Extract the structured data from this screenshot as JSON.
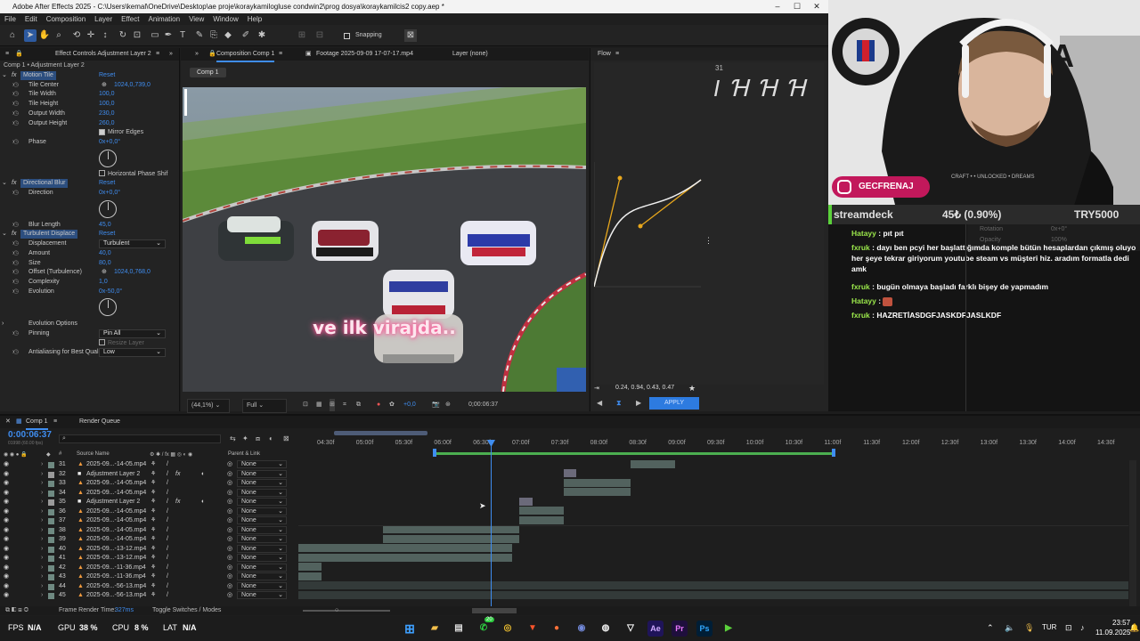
{
  "window": {
    "title": "Adobe After Effects 2025 - C:\\Users\\kemal\\OneDrive\\Desktop\\ae proje\\koraykamilogluse condwin2\\prog dosya\\koraykamilcis2 copy.aep *"
  },
  "menu": [
    "File",
    "Edit",
    "Composition",
    "Layer",
    "Effect",
    "Animation",
    "View",
    "Window",
    "Help"
  ],
  "toolbar": {
    "snapping": "Snapping"
  },
  "effects_panel": {
    "tab": "Effect Controls Adjustment Layer 2",
    "subtitle": "Comp 1 • Adjustment Layer 2",
    "rows": [
      {
        "label": "Motion Tile",
        "value": "Reset",
        "kind": "fx"
      },
      {
        "label": "Tile Center",
        "value": "1024,0,739,0",
        "kind": "prop"
      },
      {
        "label": "Tile Width",
        "value": "100,0",
        "kind": "prop"
      },
      {
        "label": "Tile Height",
        "value": "100,0",
        "kind": "prop"
      },
      {
        "label": "Output Width",
        "value": "230,0",
        "kind": "prop"
      },
      {
        "label": "Output Height",
        "value": "260,0",
        "kind": "prop"
      },
      {
        "label": "",
        "value": "Mirror Edges",
        "kind": "check"
      },
      {
        "label": "Phase",
        "value": "0x+0,0°",
        "kind": "prop"
      },
      {
        "label": "",
        "value": "Horizontal Phase Shif",
        "kind": "check"
      },
      {
        "label": "Directional Blur",
        "value": "Reset",
        "kind": "fx"
      },
      {
        "label": "Direction",
        "value": "0x+0,0°",
        "kind": "prop"
      },
      {
        "label": "Blur Length",
        "value": "45,0",
        "kind": "prop"
      },
      {
        "label": "Turbulent Displace",
        "value": "Reset",
        "kind": "fx"
      },
      {
        "label": "Displacement",
        "value": "Turbulent",
        "kind": "dropdown"
      },
      {
        "label": "Amount",
        "value": "40,0",
        "kind": "prop"
      },
      {
        "label": "Size",
        "value": "80,0",
        "kind": "prop"
      },
      {
        "label": "Offset (Turbulence)",
        "value": "1024,0,768,0",
        "kind": "prop"
      },
      {
        "label": "Complexity",
        "value": "1,0",
        "kind": "prop"
      },
      {
        "label": "Evolution",
        "value": "0x-50,0°",
        "kind": "prop"
      },
      {
        "label": "Evolution Options",
        "value": "",
        "kind": "group"
      },
      {
        "label": "Pinning",
        "value": "Pin All",
        "kind": "dropdown"
      },
      {
        "label": "",
        "value": "Resize Layer",
        "kind": "check"
      },
      {
        "label": "Antialiasing for Best Qual",
        "value": "Low",
        "kind": "dropdown"
      }
    ]
  },
  "composition": {
    "tab": "Composition Comp 1",
    "footage_tab": "Footage 2025-09-09 17-07-17.mp4",
    "layer_tab": "Layer (none)",
    "comp_chip": "Comp 1",
    "subtitle": "ve ilk virajda..",
    "zoom": "(44,1%)",
    "resolution": "Full",
    "exposure": "+0,0",
    "timecode": "0;00:06:37"
  },
  "flow": {
    "tab": "Flow",
    "values": "0.24, 0.94, 0.43, 0.47",
    "apply": "APPLY",
    "counter": "31"
  },
  "stream": {
    "instagram": "GECFRENAJ",
    "ticker": "streamdeck",
    "price": "45₺ (0.90%)",
    "currency": "TRY5000",
    "rotation": "Rotation",
    "opacity": "Opacity",
    "rotation_val": "0x+0°",
    "opacity_val": "100%"
  },
  "chat": [
    {
      "user": "Hatayy",
      "msg": "pıt pıt"
    },
    {
      "user": "fxruk",
      "msg": "dayı ben pcyi her başlattığımda komple bütün hesaplardan çıkmış oluyo her şeye tekrar giriyorum youtube steam vs müşteri hiz. aradım formatla dedi amk"
    },
    {
      "user": "fxruk",
      "msg": "bugün olmaya başladı farklı bişey de yapmadım"
    },
    {
      "user": "Hatayy",
      "msg": ""
    },
    {
      "user": "fxruk",
      "msg": "HAZRETİASDGFJASKDFJASLKDF"
    }
  ],
  "timeline": {
    "tab": "Comp 1",
    "render_queue": "Render Queue",
    "timecode": "0:00:06:37",
    "fps": "01998 (60.00 fps)",
    "col_source": "Source Name",
    "col_parent": "Parent & Link",
    "ticks": [
      "04:30f",
      "05:00f",
      "05:30f",
      "06:00f",
      "06:30f",
      "07:00f",
      "07:30f",
      "08:00f",
      "08:30f",
      "09:00f",
      "09:30f",
      "10:00f",
      "10:30f",
      "11:00f",
      "11:30f",
      "12:00f",
      "12:30f",
      "13:00f",
      "13:30f",
      "14:00f",
      "14:30f"
    ],
    "layers": [
      {
        "num": "31",
        "name": "2025-09...-14-05.mp4",
        "parent": "None"
      },
      {
        "num": "32",
        "name": "Adjustment Layer 2",
        "parent": "None"
      },
      {
        "num": "33",
        "name": "2025-09...-14-05.mp4",
        "parent": "None"
      },
      {
        "num": "34",
        "name": "2025-09...-14-05.mp4",
        "parent": "None"
      },
      {
        "num": "35",
        "name": "Adjustment Layer 2",
        "parent": "None"
      },
      {
        "num": "36",
        "name": "2025-09...-14-05.mp4",
        "parent": "None"
      },
      {
        "num": "37",
        "name": "2025-09...-14-05.mp4",
        "parent": "None"
      },
      {
        "num": "38",
        "name": "2025-09...-14-05.mp4",
        "parent": "None"
      },
      {
        "num": "39",
        "name": "2025-09...-14-05.mp4",
        "parent": "None"
      },
      {
        "num": "40",
        "name": "2025-09...-13-12.mp4",
        "parent": "None"
      },
      {
        "num": "41",
        "name": "2025-09...-13-12.mp4",
        "parent": "None"
      },
      {
        "num": "42",
        "name": "2025-09...-11-36.mp4",
        "parent": "None"
      },
      {
        "num": "43",
        "name": "2025-09...-11-36.mp4",
        "parent": "None"
      },
      {
        "num": "44",
        "name": "2025-09...-56-13.mp4",
        "parent": "None"
      },
      {
        "num": "45",
        "name": "2025-09...-56-13.mp4",
        "parent": "None"
      }
    ],
    "frame_render_label": "Frame Render Time:",
    "frame_render_value": "327ms",
    "toggle_label": "Toggle Switches / Modes"
  },
  "taskbar": {
    "fps_label": "FPS",
    "fps_value": "N/A",
    "gpu_label": "GPU",
    "gpu_value": "38 %",
    "cpu_label": "CPU",
    "cpu_value": "8 %",
    "lat_label": "LAT",
    "lat_value": "N/A",
    "lang": "TUR",
    "time": "23:57",
    "date": "11.09.2025",
    "badge": "20"
  }
}
